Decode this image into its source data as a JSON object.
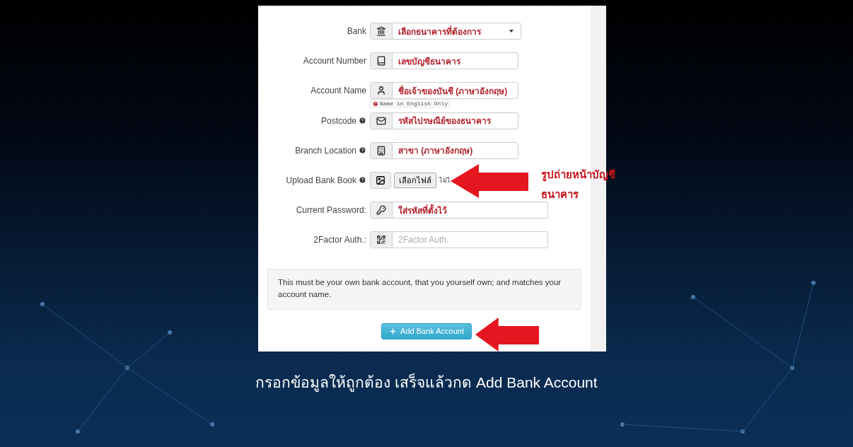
{
  "form": {
    "fields": [
      {
        "kind": "select",
        "label": "Bank",
        "help": false,
        "value": "เลือกธนาคารที่ต้องการ"
      },
      {
        "kind": "text",
        "label": "Account Number",
        "help": false,
        "value": "เลขบัญชีธนาคาร"
      },
      {
        "kind": "text",
        "label": "Account Name",
        "help": false,
        "value": "ชื่อเจ้าของบันชี (ภาษาอังกฤษ)",
        "hint": "Name in English Only"
      },
      {
        "kind": "text",
        "label": "Postcode",
        "help": true,
        "value": "รหัสไปรษณีย์ของธนาคาร"
      },
      {
        "kind": "text",
        "label": "Branch Location",
        "help": true,
        "value": "สาขา (ภาษาอังกฤษ)"
      },
      {
        "kind": "file",
        "label": "Upload Bank Book",
        "help": true,
        "button": "เลือกไฟล์",
        "status": "ไม่ไ"
      },
      {
        "kind": "wide",
        "label": "Current Password:",
        "help": false,
        "value": "ใส่รหัสที่ตั้งไว้"
      },
      {
        "kind": "wide",
        "label": "2Factor Auth.:",
        "help": false,
        "placeholder": "2Factor Auth."
      }
    ],
    "notice": "This must be your own bank account, that you yourself own; and matches your account name.",
    "submit": "Add Bank Account"
  },
  "annotations": {
    "upload_note": [
      "รูปถ่ายหน้าบัญชี",
      "ธนาคาร"
    ]
  },
  "caption": "กรอกข้อมูลให้ถูกต้อง เสร็จแล้วกด Add Bank Account"
}
